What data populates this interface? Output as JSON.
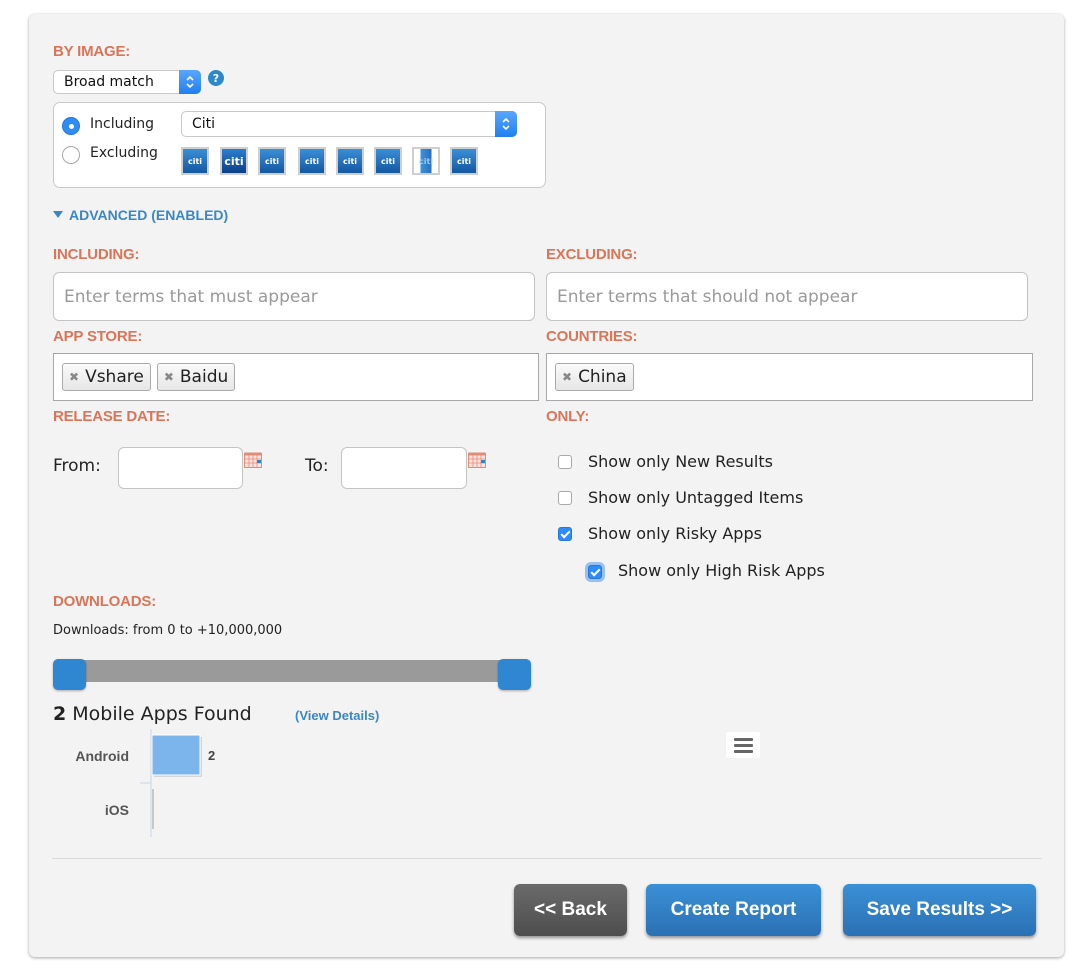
{
  "by_image": {
    "label": "BY IMAGE:",
    "match_select": {
      "value": "Broad match"
    },
    "help_icon": "?",
    "mode": {
      "including_label": "Including",
      "excluding_label": "Excluding",
      "selected": "Including"
    },
    "brand_select": {
      "value": "Citi"
    },
    "thumbnails": [
      "citi",
      "citi",
      "citi",
      "citi",
      "citi",
      "citi",
      "citi",
      "citi"
    ]
  },
  "advanced": {
    "toggle_label": "ADVANCED (ENABLED)",
    "including": {
      "label": "INCLUDING:",
      "placeholder": "Enter terms that must appear",
      "value": ""
    },
    "excluding": {
      "label": "EXCLUDING:",
      "placeholder": "Enter terms that should not appear",
      "value": ""
    },
    "app_store": {
      "label": "APP STORE:",
      "tags": [
        "Vshare",
        "Baidu"
      ]
    },
    "countries": {
      "label": "COUNTRIES:",
      "tags": [
        "China"
      ]
    },
    "release_date": {
      "label": "RELEASE DATE:",
      "from_label": "From:",
      "to_label": "To:",
      "from_value": "",
      "to_value": ""
    },
    "only": {
      "label": "ONLY:",
      "options": [
        {
          "label": "Show only New Results",
          "checked": false
        },
        {
          "label": "Show only Untagged Items",
          "checked": false
        },
        {
          "label": "Show only Risky Apps",
          "checked": true
        },
        {
          "label": "Show only High Risk Apps",
          "checked": true
        }
      ]
    },
    "downloads": {
      "label": "DOWNLOADS:",
      "range_text": "Downloads: from 0 to +10,000,000",
      "min": 0,
      "max": 10000000,
      "low_fraction": 0,
      "high_fraction": 1
    }
  },
  "results": {
    "count": "2",
    "count_suffix": "Mobile Apps Found",
    "view_details": "(View Details)",
    "menu_icon": "hamburger-menu-icon"
  },
  "chart_data": {
    "type": "bar",
    "orientation": "horizontal",
    "categories": [
      "Android",
      "iOS"
    ],
    "values": [
      2,
      0
    ],
    "data_labels": [
      "2",
      ""
    ],
    "title": "",
    "xlabel": "",
    "ylabel": "",
    "bar_color": "#7cb5ec",
    "grid": false
  },
  "buttons": {
    "back": "<< Back",
    "create_report": "Create Report",
    "save_results": "Save Results >>"
  },
  "colors": {
    "section_label": "#d9765a",
    "link": "#3a87c8",
    "primary_button": "#2f7fc4",
    "back_button": "#5a5a5a",
    "checkbox_on": "#2f8cf5"
  }
}
